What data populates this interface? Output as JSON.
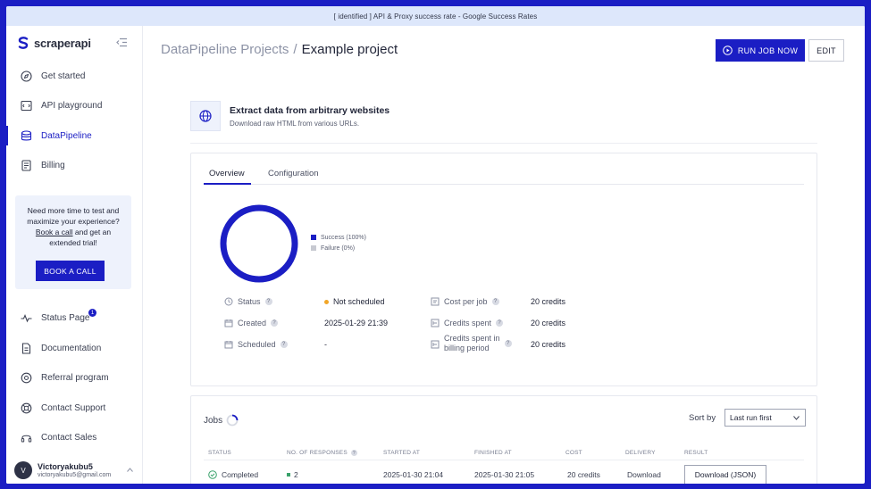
{
  "banner": {
    "text": "[ identified ] API & Proxy success rate - Google Success Rates"
  },
  "brand": {
    "name": "scraperapi",
    "color": "#1b1ec4"
  },
  "sidebar": {
    "items": [
      {
        "label": "Get started",
        "icon": "rocket-icon"
      },
      {
        "label": "API playground",
        "icon": "code-icon"
      },
      {
        "label": "DataPipeline",
        "icon": "pipeline-icon",
        "active": true
      },
      {
        "label": "Billing",
        "icon": "receipt-icon"
      }
    ],
    "trial": {
      "line1": "Need more time to test and maximize your experience?",
      "link": "Book a call",
      "line2": "and get an extended trial!",
      "button": "BOOK A CALL"
    },
    "bottom_items": [
      {
        "label": "Status Page",
        "icon": "pulse-icon",
        "badge": "1"
      },
      {
        "label": "Documentation",
        "icon": "document-icon"
      },
      {
        "label": "Referral program",
        "icon": "referral-icon"
      },
      {
        "label": "Contact Support",
        "icon": "support-icon"
      },
      {
        "label": "Contact Sales",
        "icon": "headset-icon"
      }
    ],
    "user": {
      "initial": "V",
      "name": "Victoryakubu5",
      "email": "victoryakubu5@gmail.com"
    }
  },
  "header": {
    "breadcrumb_parent": "DataPipeline Projects",
    "breadcrumb_sep": "/",
    "breadcrumb_current": "Example project",
    "run_button": "RUN JOB NOW",
    "edit_button": "EDIT"
  },
  "project": {
    "title": "Extract data from arbitrary websites",
    "subtitle": "Download raw HTML from various URLs."
  },
  "tabs": [
    {
      "label": "Overview",
      "active": true
    },
    {
      "label": "Configuration"
    }
  ],
  "chart_data": {
    "type": "pie",
    "categories": [
      "Success",
      "Failure"
    ],
    "values": [
      100,
      0
    ],
    "legend": [
      "Success (100%)",
      "Failure (0%)"
    ],
    "colors": [
      "#1b1ec4",
      "#c7c9d1"
    ],
    "legend_position": "right"
  },
  "details": {
    "status_label": "Status",
    "status_value": "Not scheduled",
    "status_color": "#f1a627",
    "created_label": "Created",
    "created_value": "2025-01-29 21:39",
    "scheduled_label": "Scheduled",
    "scheduled_value": "-",
    "cost_label": "Cost per job",
    "cost_value": "20 credits",
    "spent_label": "Credits spent",
    "spent_value": "20 credits",
    "billing_label_1": "Credits spent in",
    "billing_label_2": "billing period",
    "billing_value": "20 credits"
  },
  "jobs": {
    "title": "Jobs",
    "sort_label": "Sort by",
    "sort_value": "Last run first",
    "columns": [
      "STATUS",
      "NO. OF RESPONSES",
      "STARTED AT",
      "FINISHED AT",
      "COST",
      "DELIVERY",
      "RESULT"
    ],
    "rows": [
      {
        "status": "Completed",
        "responses": "2",
        "started": "2025-01-30 21:04",
        "finished": "2025-01-30 21:05",
        "cost": "20 credits",
        "delivery": "Download",
        "result": "Download (JSON)"
      }
    ]
  }
}
